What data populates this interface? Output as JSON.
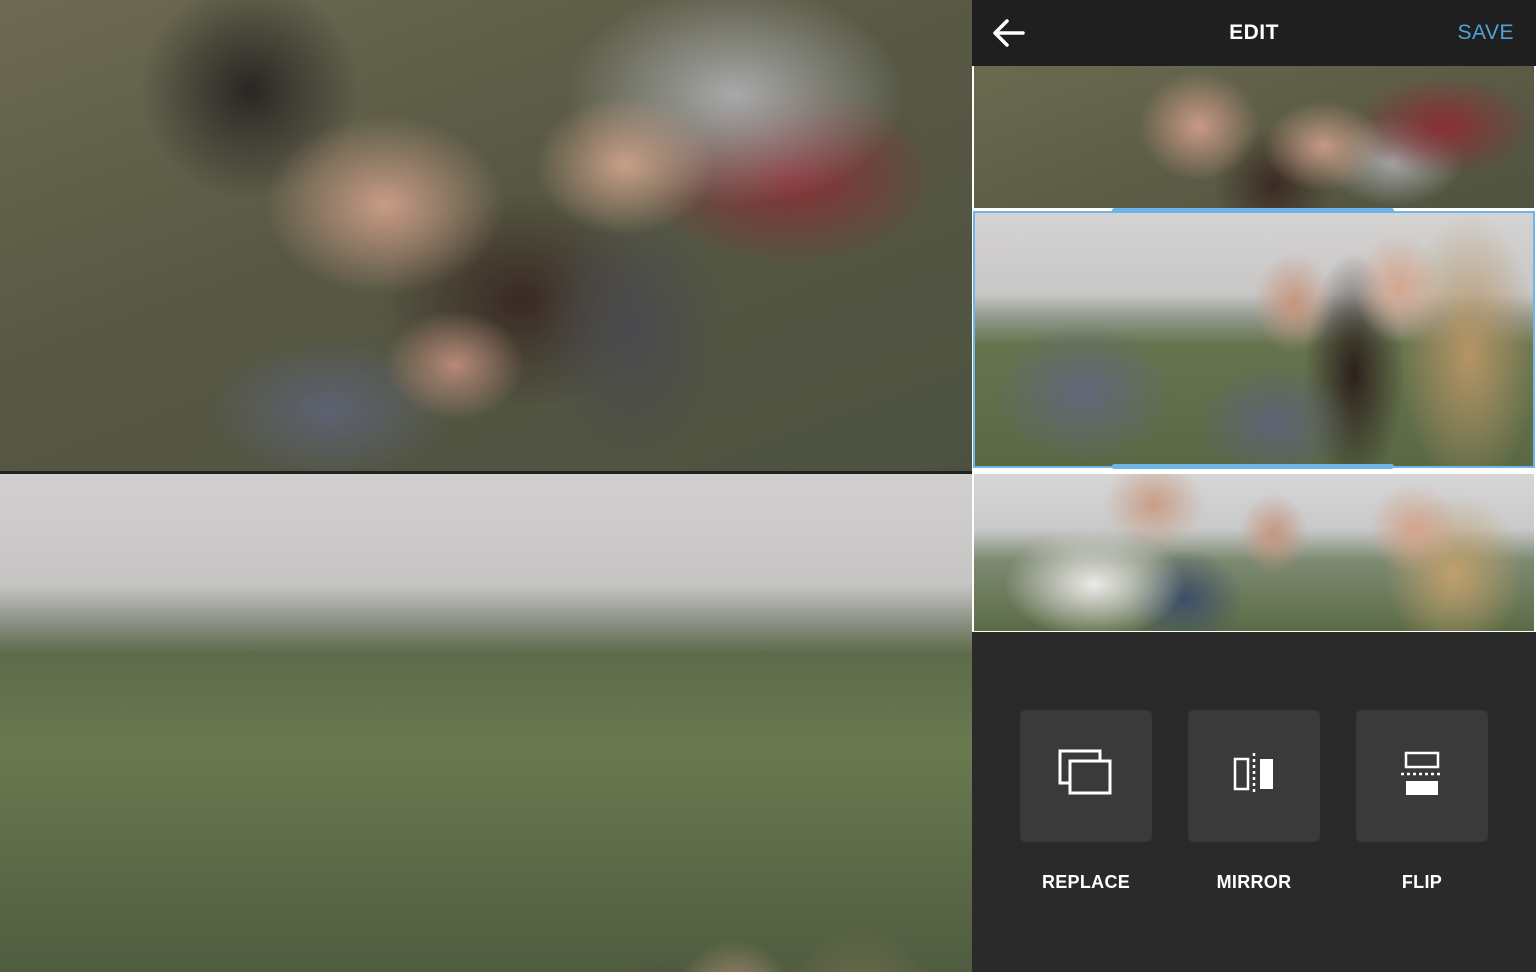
{
  "header": {
    "title": "EDIT",
    "save_label": "SAVE"
  },
  "tools": [
    {
      "label": "REPLACE",
      "icon": "replace-icon"
    },
    {
      "label": "MIRROR",
      "icon": "mirror-icon"
    },
    {
      "label": "FLIP",
      "icon": "flip-icon"
    }
  ],
  "colors": {
    "accent": "#4fa3d6",
    "selection": "#6fb6e8",
    "panel_bg": "#2a2a2a",
    "topbar_bg": "#1f1f1f",
    "tool_bg": "#3a3a3a"
  }
}
